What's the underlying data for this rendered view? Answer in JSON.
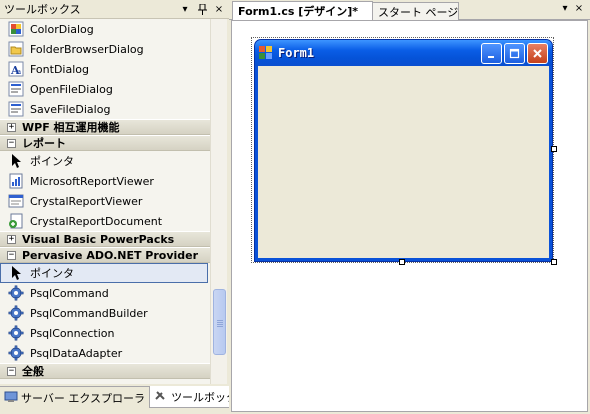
{
  "toolbox": {
    "title": "ツールボックス",
    "pin_glyph": "▾",
    "autohide_glyph": "ꟾ",
    "close_glyph": "×",
    "items_top": [
      {
        "label": "ColorDialog",
        "icon": "color-dialog-icon"
      },
      {
        "label": "FolderBrowserDialog",
        "icon": "folder-browser-icon"
      },
      {
        "label": "FontDialog",
        "icon": "font-dialog-icon"
      },
      {
        "label": "OpenFileDialog",
        "icon": "open-file-icon"
      },
      {
        "label": "SaveFileDialog",
        "icon": "save-file-icon"
      }
    ],
    "categories": {
      "wpf": "WPF 相互運用機能",
      "report": "レポート",
      "vbpp": "Visual Basic PowerPacks",
      "pervasive": "Pervasive ADO.NET Provider",
      "general": "全般"
    },
    "report_items": [
      {
        "label": "ポインタ",
        "icon": "pointer-icon"
      },
      {
        "label": "MicrosoftReportViewer",
        "icon": "report-viewer-icon"
      },
      {
        "label": "CrystalReportViewer",
        "icon": "crystal-viewer-icon"
      },
      {
        "label": "CrystalReportDocument",
        "icon": "crystal-document-icon"
      }
    ],
    "pervasive_items": [
      {
        "label": "ポインタ",
        "icon": "pointer-icon"
      },
      {
        "label": "PsqlCommand",
        "icon": "gear-icon"
      },
      {
        "label": "PsqlCommandBuilder",
        "icon": "gear-icon"
      },
      {
        "label": "PsqlConnection",
        "icon": "gear-icon"
      },
      {
        "label": "PsqlDataAdapter",
        "icon": "gear-icon"
      }
    ],
    "bottom_tabs": [
      {
        "label": "サーバー エクスプローラ"
      },
      {
        "label": "ツールボックス"
      }
    ]
  },
  "designer": {
    "tabs": [
      {
        "label": "Form1.cs [デザイン]*"
      },
      {
        "label": "スタート ページ"
      }
    ],
    "tab_dropdown": "▾",
    "tab_close": "×",
    "form": {
      "title": "Form1"
    }
  },
  "colors": {
    "titlebar_blue": "#0a5de6",
    "close_red": "#c4411c",
    "panel_bg": "#ece9d8",
    "selection_border": "#4a6ea9"
  }
}
